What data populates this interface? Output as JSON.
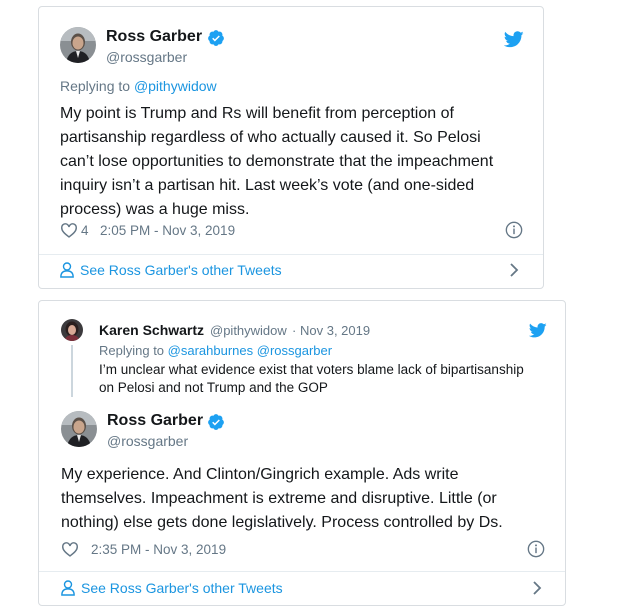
{
  "colors": {
    "link": "#1b95e0",
    "muted": "#657786",
    "text": "#14171a",
    "verified": "#1da1f2",
    "bird": "#1da1f2"
  },
  "tweet1": {
    "name": "Ross Garber",
    "handle": "@rossgarber",
    "replying_prefix": "Replying to",
    "replying_to": "@pithywidow",
    "lines": [
      "My point is Trump and Rs will benefit from perception of",
      "partisanship regardless of who actually caused it. So Pelosi",
      "can’t lose opportunities to demonstrate that the impeachment",
      "inquiry isn’t a partisan hit. Last week’s vote (and one-sided",
      "process) was a huge miss."
    ],
    "likes": "4",
    "timestamp": "2:05 PM - Nov 3, 2019",
    "see_more": "See Ross Garber's other Tweets",
    "icons": [
      "twitter-bird-icon",
      "verified-badge-icon",
      "heart-icon",
      "info-icon",
      "person-icon",
      "chevron-right-icon"
    ]
  },
  "tweet2": {
    "quoted": {
      "name": "Karen Schwartz",
      "handle": "@pithywidow",
      "date": "Nov 3, 2019",
      "replying_prefix": "Replying to",
      "replying_to": "@sarahburnes @rossgarber",
      "lines": [
        "I’m unclear what evidence exist that voters blame lack of bipartisanship",
        "on Pelosi and not Trump and the GOP"
      ]
    },
    "name": "Ross Garber",
    "handle": "@rossgarber",
    "lines": [
      "My experience. And Clinton/Gingrich example. Ads write",
      "themselves. Impeachment is extreme and disruptive. Little (or",
      "nothing) else gets done legislatively. Process controlled by Ds."
    ],
    "timestamp": "2:35 PM - Nov 3, 2019",
    "see_more": "See Ross Garber's other Tweets",
    "icons": [
      "twitter-bird-icon",
      "verified-badge-icon",
      "heart-icon",
      "info-icon",
      "person-icon",
      "chevron-right-icon"
    ]
  }
}
